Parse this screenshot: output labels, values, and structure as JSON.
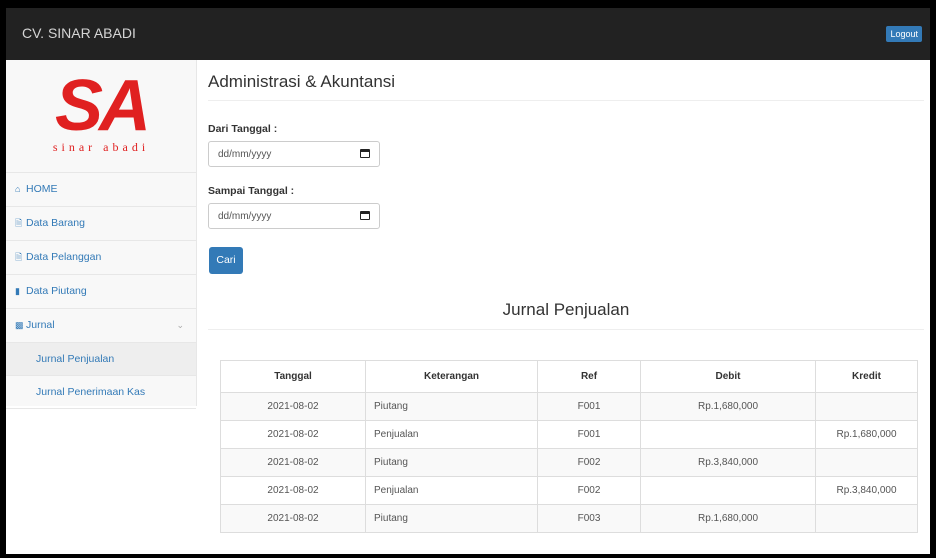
{
  "header": {
    "brand": "CV. SINAR ABADI",
    "logout_label": "Logout"
  },
  "logo": {
    "main": "SA",
    "sub": "sinar abadi"
  },
  "sidebar": {
    "items": [
      {
        "icon": "home-icon",
        "label": "HOME"
      },
      {
        "icon": "file-icon",
        "label": "Data Barang"
      },
      {
        "icon": "file-icon",
        "label": "Data Pelanggan"
      },
      {
        "icon": "book-icon",
        "label": "Data Piutang"
      },
      {
        "icon": "chart-icon",
        "label": "Jurnal"
      }
    ],
    "subitems": [
      {
        "label": "Jurnal Penjualan",
        "active": true
      },
      {
        "label": "Jurnal Penerimaan Kas",
        "active": false
      }
    ]
  },
  "main": {
    "title": "Administrasi & Akuntansi",
    "from_label": "Dari Tanggal :",
    "from_placeholder": "dd/mm/yyyy",
    "to_label": "Sampai Tanggal :",
    "to_placeholder": "dd/mm/yyyy",
    "search_label": "Cari",
    "section_title": "Jurnal Penjualan"
  },
  "table": {
    "headers": [
      "Tanggal",
      "Keterangan",
      "Ref",
      "Debit",
      "Kredit"
    ],
    "rows": [
      [
        "2021-08-02",
        "Piutang",
        "F001",
        "Rp.1,680,000",
        ""
      ],
      [
        "2021-08-02",
        "Penjualan",
        "F001",
        "",
        "Rp.1,680,000"
      ],
      [
        "2021-08-02",
        "Piutang",
        "F002",
        "Rp.3,840,000",
        ""
      ],
      [
        "2021-08-02",
        "Penjualan",
        "F002",
        "",
        "Rp.3,840,000"
      ],
      [
        "2021-08-02",
        "Piutang",
        "F003",
        "Rp.1,680,000",
        ""
      ]
    ]
  },
  "colors": {
    "accent": "#337ab7",
    "topbar": "#222222",
    "logo": "#e02020"
  }
}
